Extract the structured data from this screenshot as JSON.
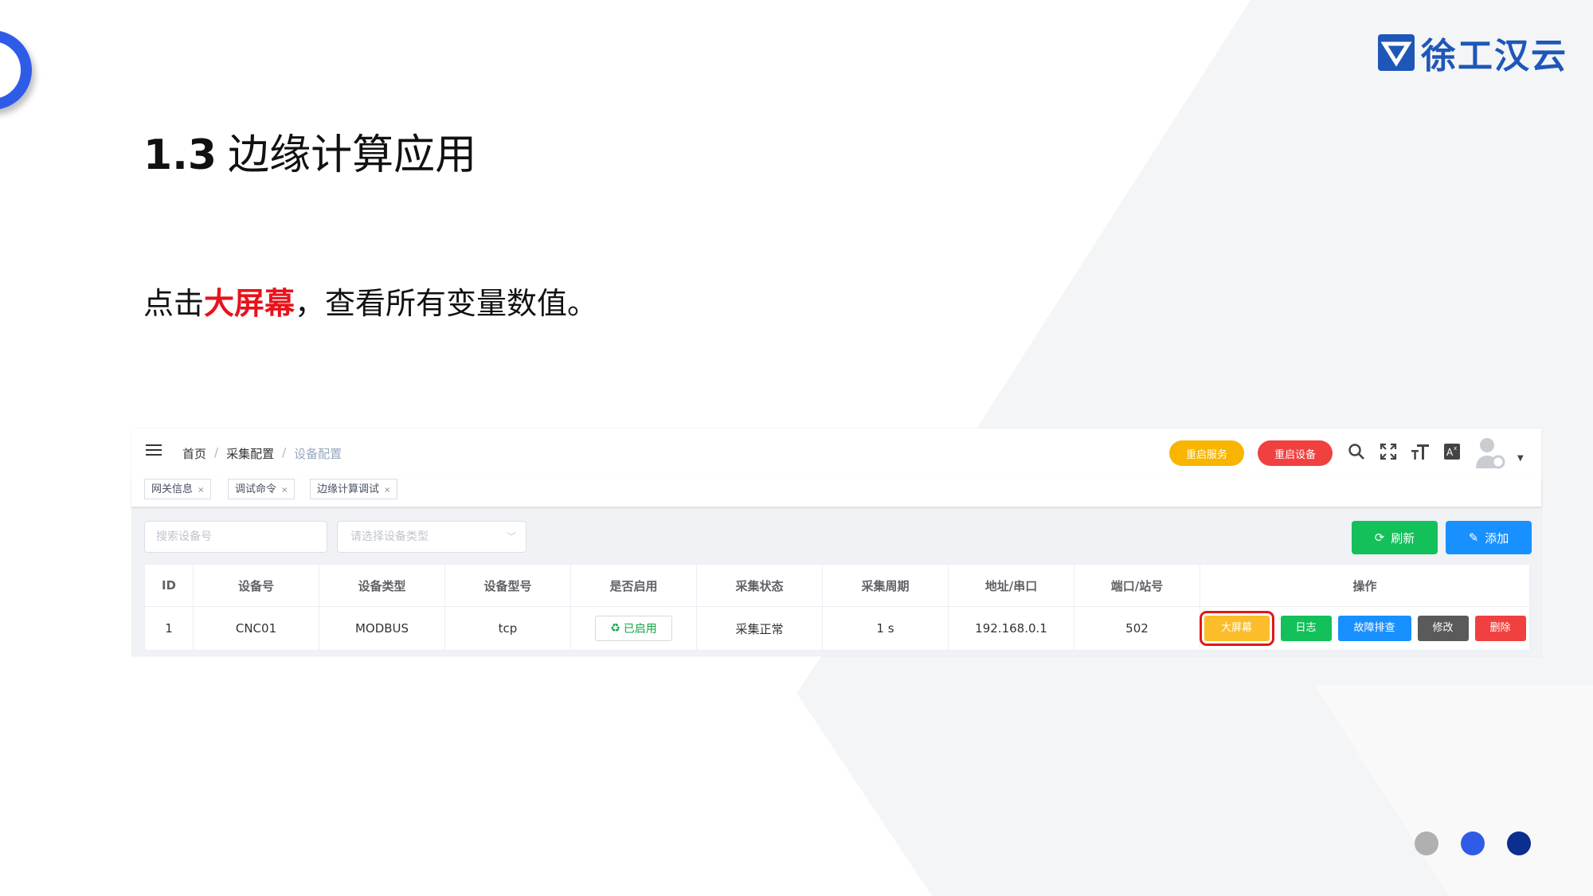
{
  "slide": {
    "title_number": "1.3",
    "title_text": "边缘计算应用",
    "instruction_prefix": "点击",
    "instruction_highlight": "大屏幕",
    "instruction_suffix": "，查看所有变量数值。"
  },
  "logo": {
    "text": "徐工汉云",
    "color": "#1e57b8"
  },
  "app": {
    "breadcrumb": [
      "首页",
      "采集配置",
      "设备配置"
    ],
    "breadcrumb_sep": "/",
    "header_buttons": {
      "restart_service": "重启服务",
      "restart_device": "重启设备"
    },
    "icons": [
      "menu-icon",
      "search-icon",
      "fullscreen-icon",
      "font-size-icon",
      "translate-icon",
      "user-avatar-icon"
    ],
    "tags": [
      {
        "label": "网关信息",
        "close": "×"
      },
      {
        "label": "调试命令",
        "close": "×"
      },
      {
        "label": "边缘计算调试",
        "close": "×"
      }
    ],
    "search_placeholder": "搜索设备号",
    "select_placeholder": "请选择设备类型",
    "buttons": {
      "refresh": "刷新",
      "add": "添加"
    },
    "table": {
      "headers": [
        "ID",
        "设备号",
        "设备类型",
        "设备型号",
        "是否启用",
        "采集状态",
        "采集周期",
        "地址/串口",
        "端口/站号",
        "操作"
      ],
      "row": {
        "id": "1",
        "device_no": "CNC01",
        "device_type": "MODBUS",
        "device_model": "tcp",
        "enabled": "已启用",
        "status": "采集正常",
        "period": "1 s",
        "address": "192.168.0.1",
        "port": "502"
      },
      "actions": [
        "大屏幕",
        "日志",
        "故障排查",
        "修改",
        "删除"
      ]
    }
  },
  "colors": {
    "accent_blue": "#2f5ce6",
    "highlight_red": "#e8121b",
    "success_green": "#13c05a",
    "primary_blue": "#1890ff",
    "warning_yellow": "#f7b500",
    "danger_red": "#f04040",
    "dots": [
      "#b0b0b0",
      "#2f5ce6",
      "#0a2f8f"
    ]
  }
}
